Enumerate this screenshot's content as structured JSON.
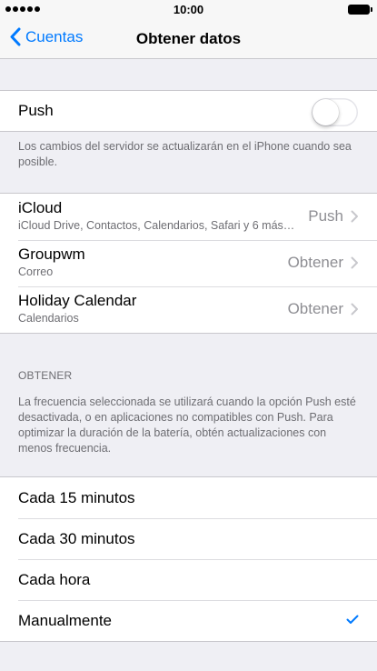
{
  "status_bar": {
    "time": "10:00"
  },
  "nav": {
    "back_label": "Cuentas",
    "title": "Obtener datos"
  },
  "push": {
    "label": "Push",
    "enabled": false,
    "footer": "Los cambios del servidor se actualizarán en el iPhone cuando sea posible."
  },
  "accounts": [
    {
      "name": "iCloud",
      "detail": "iCloud Drive, Contactos, Calendarios, Safari y 6 más…",
      "value": "Push"
    },
    {
      "name": "Groupwm",
      "detail": "Correo",
      "value": "Obtener"
    },
    {
      "name": "Holiday Calendar",
      "detail": "Calendarios",
      "value": "Obtener"
    }
  ],
  "fetch": {
    "header": "OBTENER",
    "description": "La frecuencia seleccionada se utilizará cuando la opción Push esté desactivada, o en aplicaciones no compatibles con Push. Para optimizar la duración de la batería, obtén actualizaciones con menos frecuencia.",
    "options": [
      "Cada 15 minutos",
      "Cada 30 minutos",
      "Cada hora",
      "Manualmente"
    ],
    "selected_index": 3
  },
  "colors": {
    "accent": "#007aff",
    "background": "#efeff4",
    "secondary_text": "#6d6d72"
  }
}
